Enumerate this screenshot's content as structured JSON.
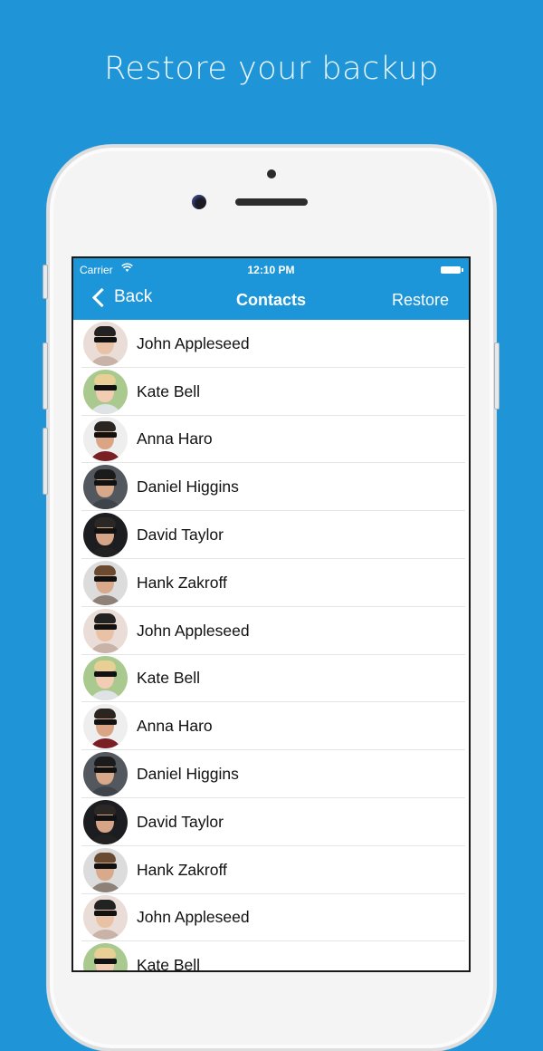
{
  "headline": "Restore your backup",
  "status_bar": {
    "carrier": "Carrier",
    "wifi_icon": "wifi-icon",
    "time": "12:10 PM",
    "battery_icon": "battery-full-icon"
  },
  "nav_bar": {
    "back_label": "Back",
    "back_icon": "chevron-left-icon",
    "title": "Contacts",
    "action_label": "Restore",
    "background_color": "#1d96d9"
  },
  "page_background_color": "#1f95d8",
  "contacts": [
    {
      "name": "John Appleseed",
      "avatar": "avatar-photo"
    },
    {
      "name": "Kate Bell",
      "avatar": "avatar-photo"
    },
    {
      "name": "Anna Haro",
      "avatar": "avatar-photo"
    },
    {
      "name": "Daniel Higgins",
      "avatar": "avatar-photo"
    },
    {
      "name": "David Taylor",
      "avatar": "avatar-photo"
    },
    {
      "name": "Hank Zakroff",
      "avatar": "avatar-photo"
    },
    {
      "name": "John Appleseed",
      "avatar": "avatar-photo"
    },
    {
      "name": "Kate Bell",
      "avatar": "avatar-photo"
    },
    {
      "name": "Anna Haro",
      "avatar": "avatar-photo"
    },
    {
      "name": "Daniel Higgins",
      "avatar": "avatar-photo"
    },
    {
      "name": "David Taylor",
      "avatar": "avatar-photo"
    },
    {
      "name": "Hank Zakroff",
      "avatar": "avatar-photo"
    },
    {
      "name": "John Appleseed",
      "avatar": "avatar-photo"
    },
    {
      "name": "Kate Bell",
      "avatar": "avatar-photo"
    }
  ]
}
